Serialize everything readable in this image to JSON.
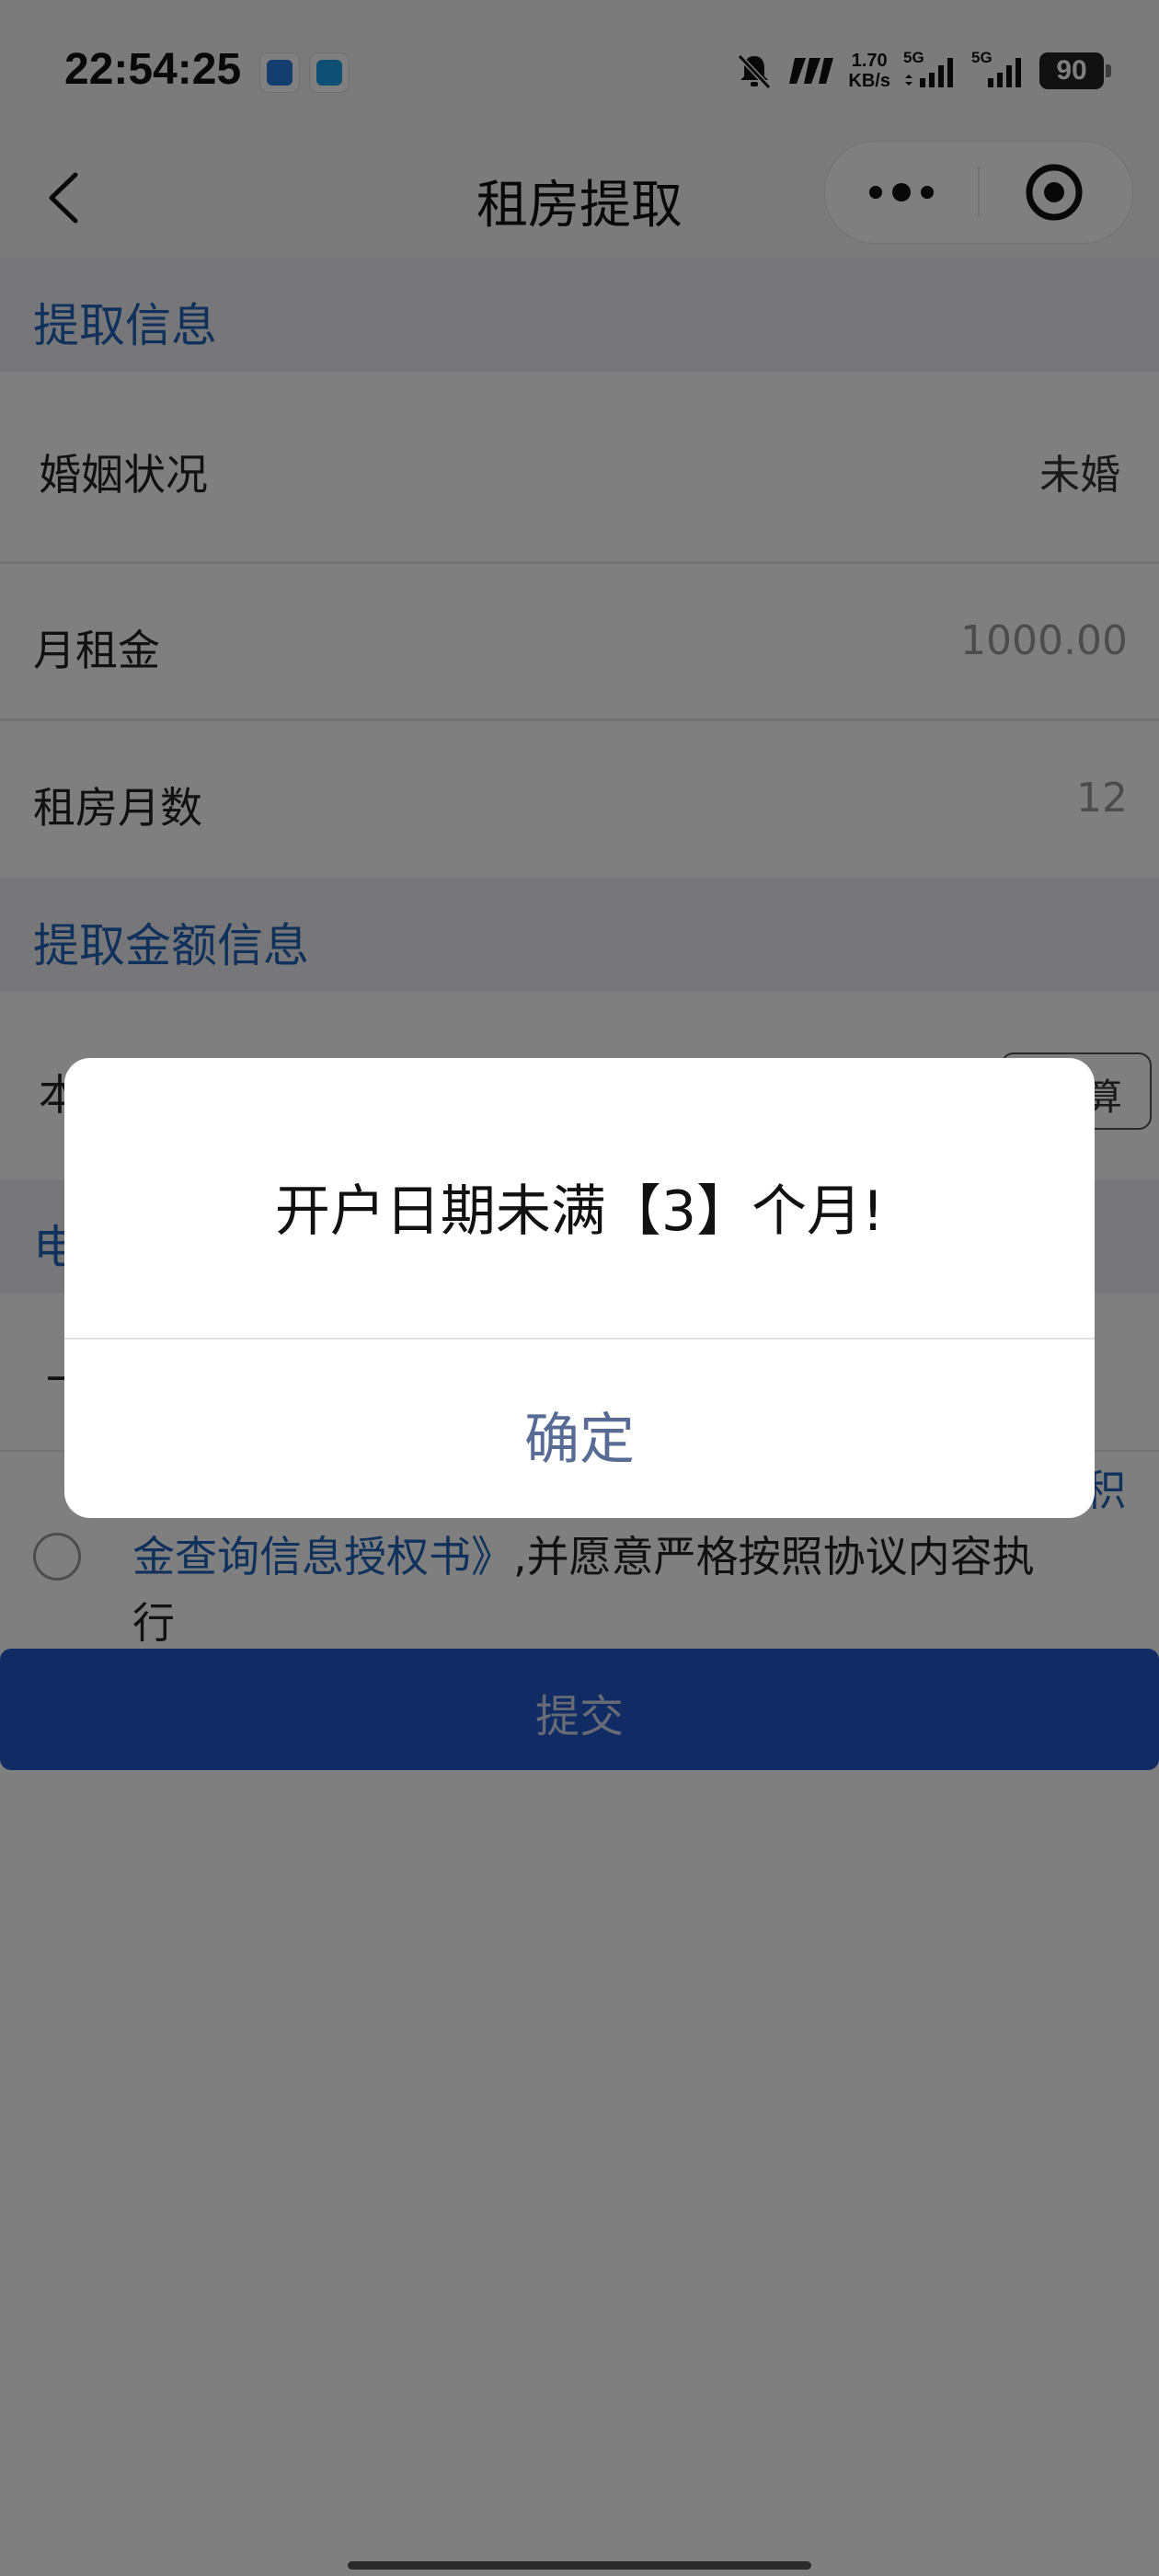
{
  "status_bar": {
    "time": "22:54:25",
    "net_speed_value": "1.70",
    "net_speed_unit": "KB/s",
    "signal_1_label": "5G",
    "signal_2_label": "5G",
    "battery": "90"
  },
  "nav": {
    "title": "租房提取"
  },
  "sections": {
    "withdraw_info": "提取信息",
    "amount_info": "提取金额信息",
    "hidden_third_initial": "电"
  },
  "form": {
    "marital_status_label": "婚姻状况",
    "marital_status_value": "未婚",
    "monthly_rent_label": "月租金",
    "monthly_rent_value": "1000.00",
    "rent_months_label": "租房月数",
    "rent_months_value": "12",
    "amount_row_initial": "本",
    "calc_button_partial": "算",
    "hidden_row_initial": "一"
  },
  "agreement": {
    "line1_tail": "积",
    "line2_link": "金查询信息授权书》",
    "line2_text": ",并愿意严格按照协议内容执",
    "line3_text": "行"
  },
  "submit_label": "提交",
  "dialog": {
    "message": "开户日期未满【3】个月!",
    "confirm_label": "确定"
  },
  "colors": {
    "accent_blue": "#1e63b7",
    "submit_blue": "#2356c9",
    "dialog_confirm": "#576b95"
  }
}
